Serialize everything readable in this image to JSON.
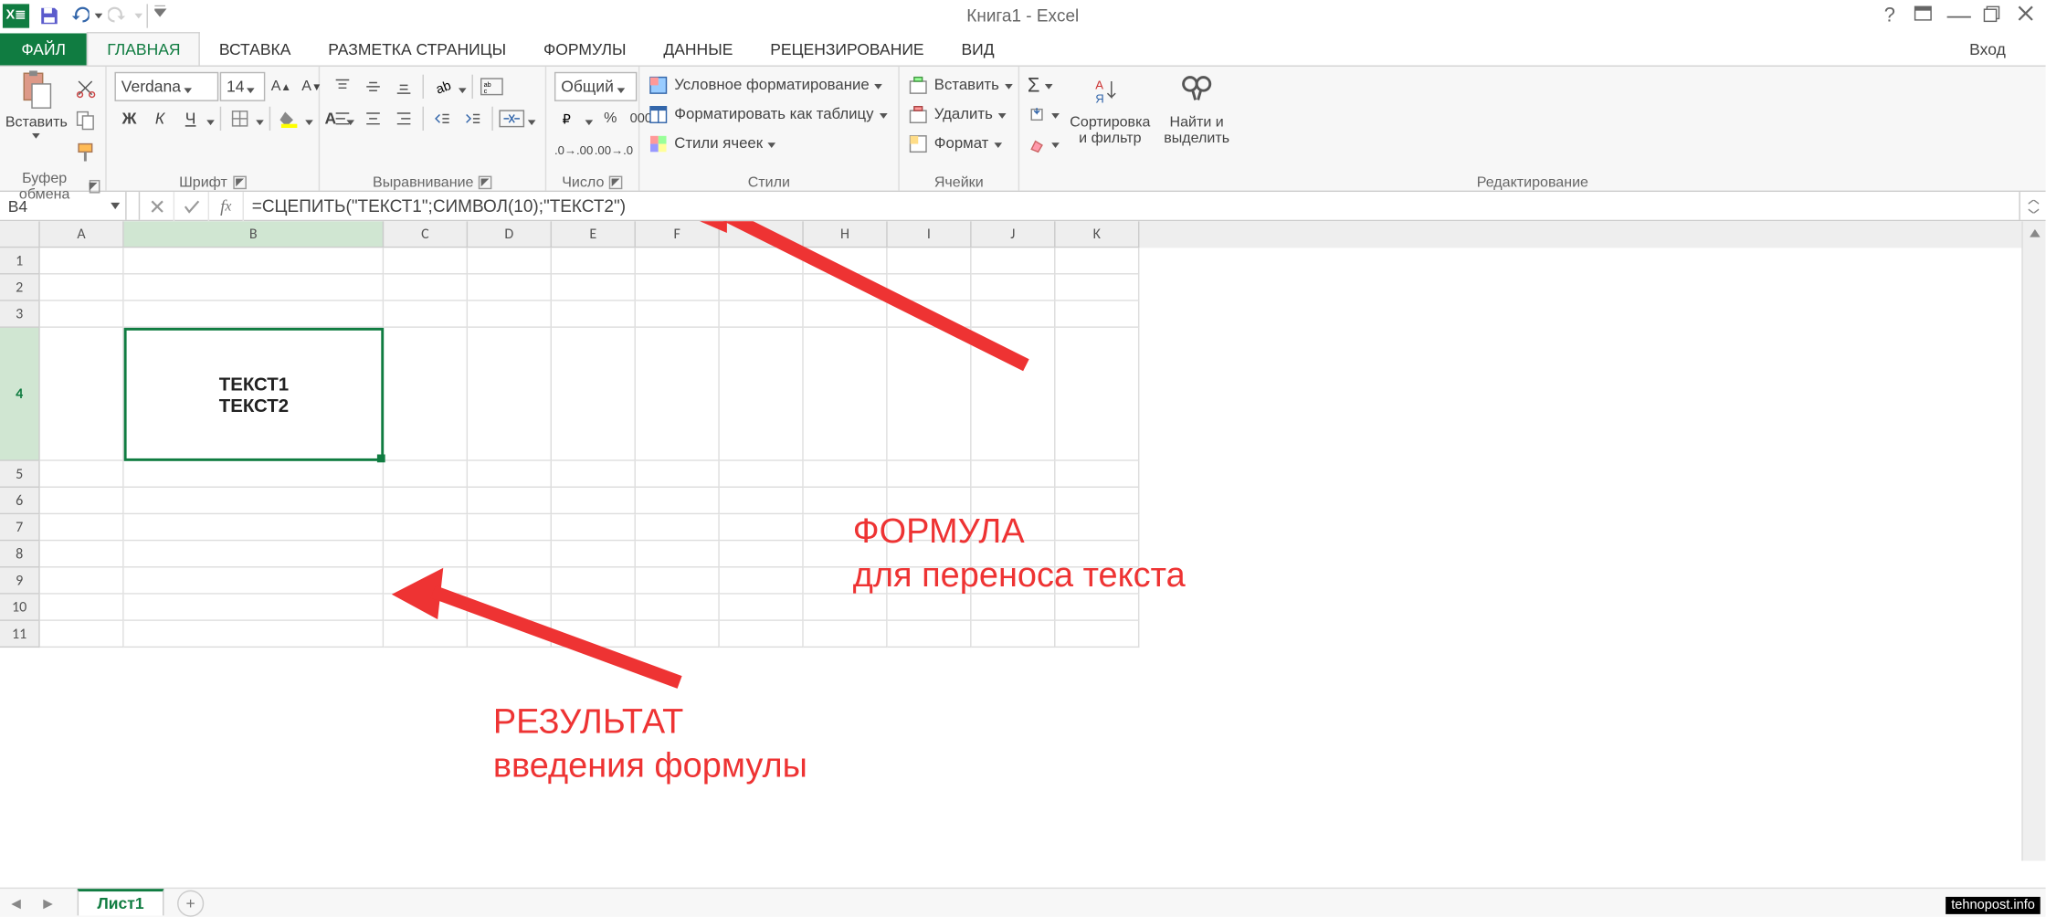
{
  "app": {
    "title": "Книга1 - Excel",
    "login": "Вход"
  },
  "qat": {
    "save_tip": "save",
    "undo_tip": "undo",
    "redo_tip": "redo"
  },
  "tabs": [
    "ФАЙЛ",
    "ГЛАВНАЯ",
    "ВСТАВКА",
    "РАЗМЕТКА СТРАНИЦЫ",
    "ФОРМУЛЫ",
    "ДАННЫЕ",
    "РЕЦЕНЗИРОВАНИЕ",
    "ВИД"
  ],
  "ribbon": {
    "clipboard": {
      "label": "Буфер обмена",
      "paste": "Вставить"
    },
    "font": {
      "label": "Шрифт",
      "name": "Verdana",
      "size": "14",
      "bold": "Ж",
      "italic": "К",
      "underline": "Ч"
    },
    "align": {
      "label": "Выравнивание"
    },
    "number": {
      "label": "Число",
      "format": "Общий"
    },
    "styles": {
      "label": "Стили",
      "cond": "Условное форматирование",
      "table": "Форматировать как таблицу",
      "cell": "Стили ячеек"
    },
    "cells": {
      "label": "Ячейки",
      "insert": "Вставить",
      "delete": "Удалить",
      "format": "Формат"
    },
    "editing": {
      "label": "Редактирование",
      "sort": "Сортировка\nи фильтр",
      "find": "Найти и\nвыделить"
    }
  },
  "namebox": "B4",
  "formula": "=СЦЕПИТЬ(\"ТЕКСТ1\";СИМВОЛ(10);\"ТЕКСТ2\")",
  "grid": {
    "columns": [
      "A",
      "B",
      "C",
      "D",
      "E",
      "F",
      "G",
      "H",
      "I",
      "J",
      "K"
    ],
    "col_widths": {
      "A": 63,
      "B": 195,
      "C": 63,
      "D": 63,
      "E": 63,
      "F": 63,
      "G": 63,
      "H": 63,
      "I": 63,
      "J": 63,
      "K": 63
    },
    "rows": [
      1,
      2,
      3,
      4,
      5,
      6,
      7,
      8,
      9,
      10,
      11
    ],
    "row_heights": {
      "1": 20,
      "2": 20,
      "3": 20,
      "4": 100,
      "5": 20,
      "6": 20,
      "7": 20,
      "8": 20,
      "9": 20,
      "10": 20,
      "11": 20
    },
    "selected_cell": "B4",
    "b4_value": "ТЕКСТ1\nТЕКСТ2"
  },
  "sheets": {
    "active": "Лист1"
  },
  "annotations": {
    "formula": "ФОРМУЛА\nдля переноса текста",
    "result": "РЕЗУЛЬТАТ\nвведения формулы"
  },
  "watermark": "tehnopost.info"
}
